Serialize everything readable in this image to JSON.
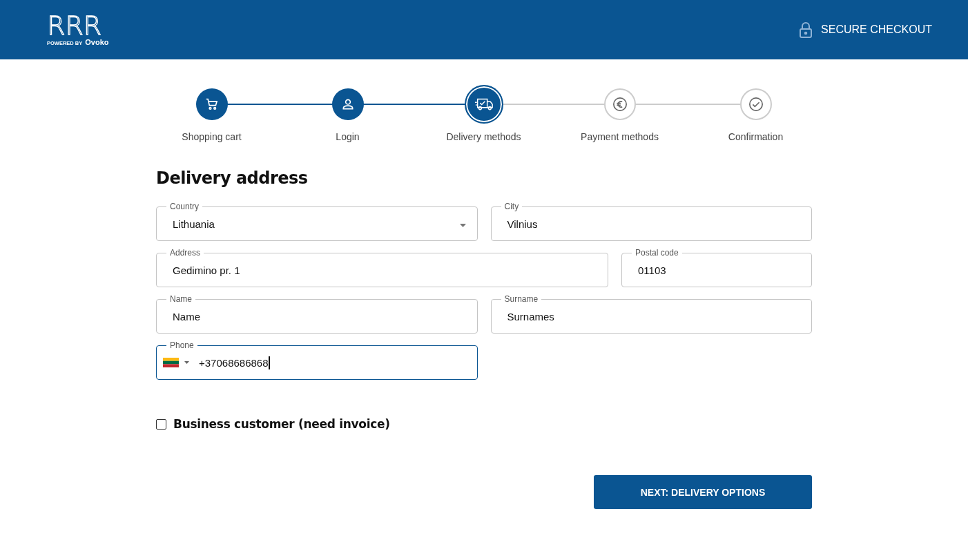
{
  "header": {
    "logo": {
      "letters": "RRR",
      "powered_by": "POWERED BY",
      "brand": "Ovoko"
    },
    "secure_label": "SECURE CHECKOUT"
  },
  "steps": [
    {
      "label": "Shopping cart",
      "kind": "cart",
      "done": true,
      "selected": false
    },
    {
      "label": "Login",
      "kind": "user",
      "done": true,
      "selected": false
    },
    {
      "label": "Delivery methods",
      "kind": "truck",
      "done": false,
      "selected": true
    },
    {
      "label": "Payment methods",
      "kind": "euro",
      "done": false,
      "selected": false
    },
    {
      "label": "Confirmation",
      "kind": "check",
      "done": false,
      "selected": false
    }
  ],
  "form": {
    "title": "Delivery address",
    "rows": [
      [
        {
          "label": "Country",
          "value": "Lithuania",
          "kind": "select",
          "focused": false
        },
        {
          "label": "City",
          "value": "Vilnius",
          "kind": "text",
          "focused": false
        }
      ],
      [
        {
          "label": "Address",
          "value": "Gedimino pr. 1",
          "kind": "text",
          "focused": false
        },
        {
          "label": "Postal code",
          "value": "01103",
          "kind": "text",
          "focused": false
        }
      ],
      [
        {
          "label": "Name",
          "value": "Name",
          "kind": "text",
          "focused": false
        },
        {
          "label": "Surname",
          "value": "Surnames",
          "kind": "text",
          "focused": false
        }
      ],
      [
        {
          "label": "Phone",
          "value": "+37068686868",
          "kind": "phone",
          "focused": true
        }
      ]
    ],
    "business": {
      "label": "Business customer (need invoice)",
      "checked": false
    },
    "submit": "NEXT: DELIVERY OPTIONS"
  }
}
